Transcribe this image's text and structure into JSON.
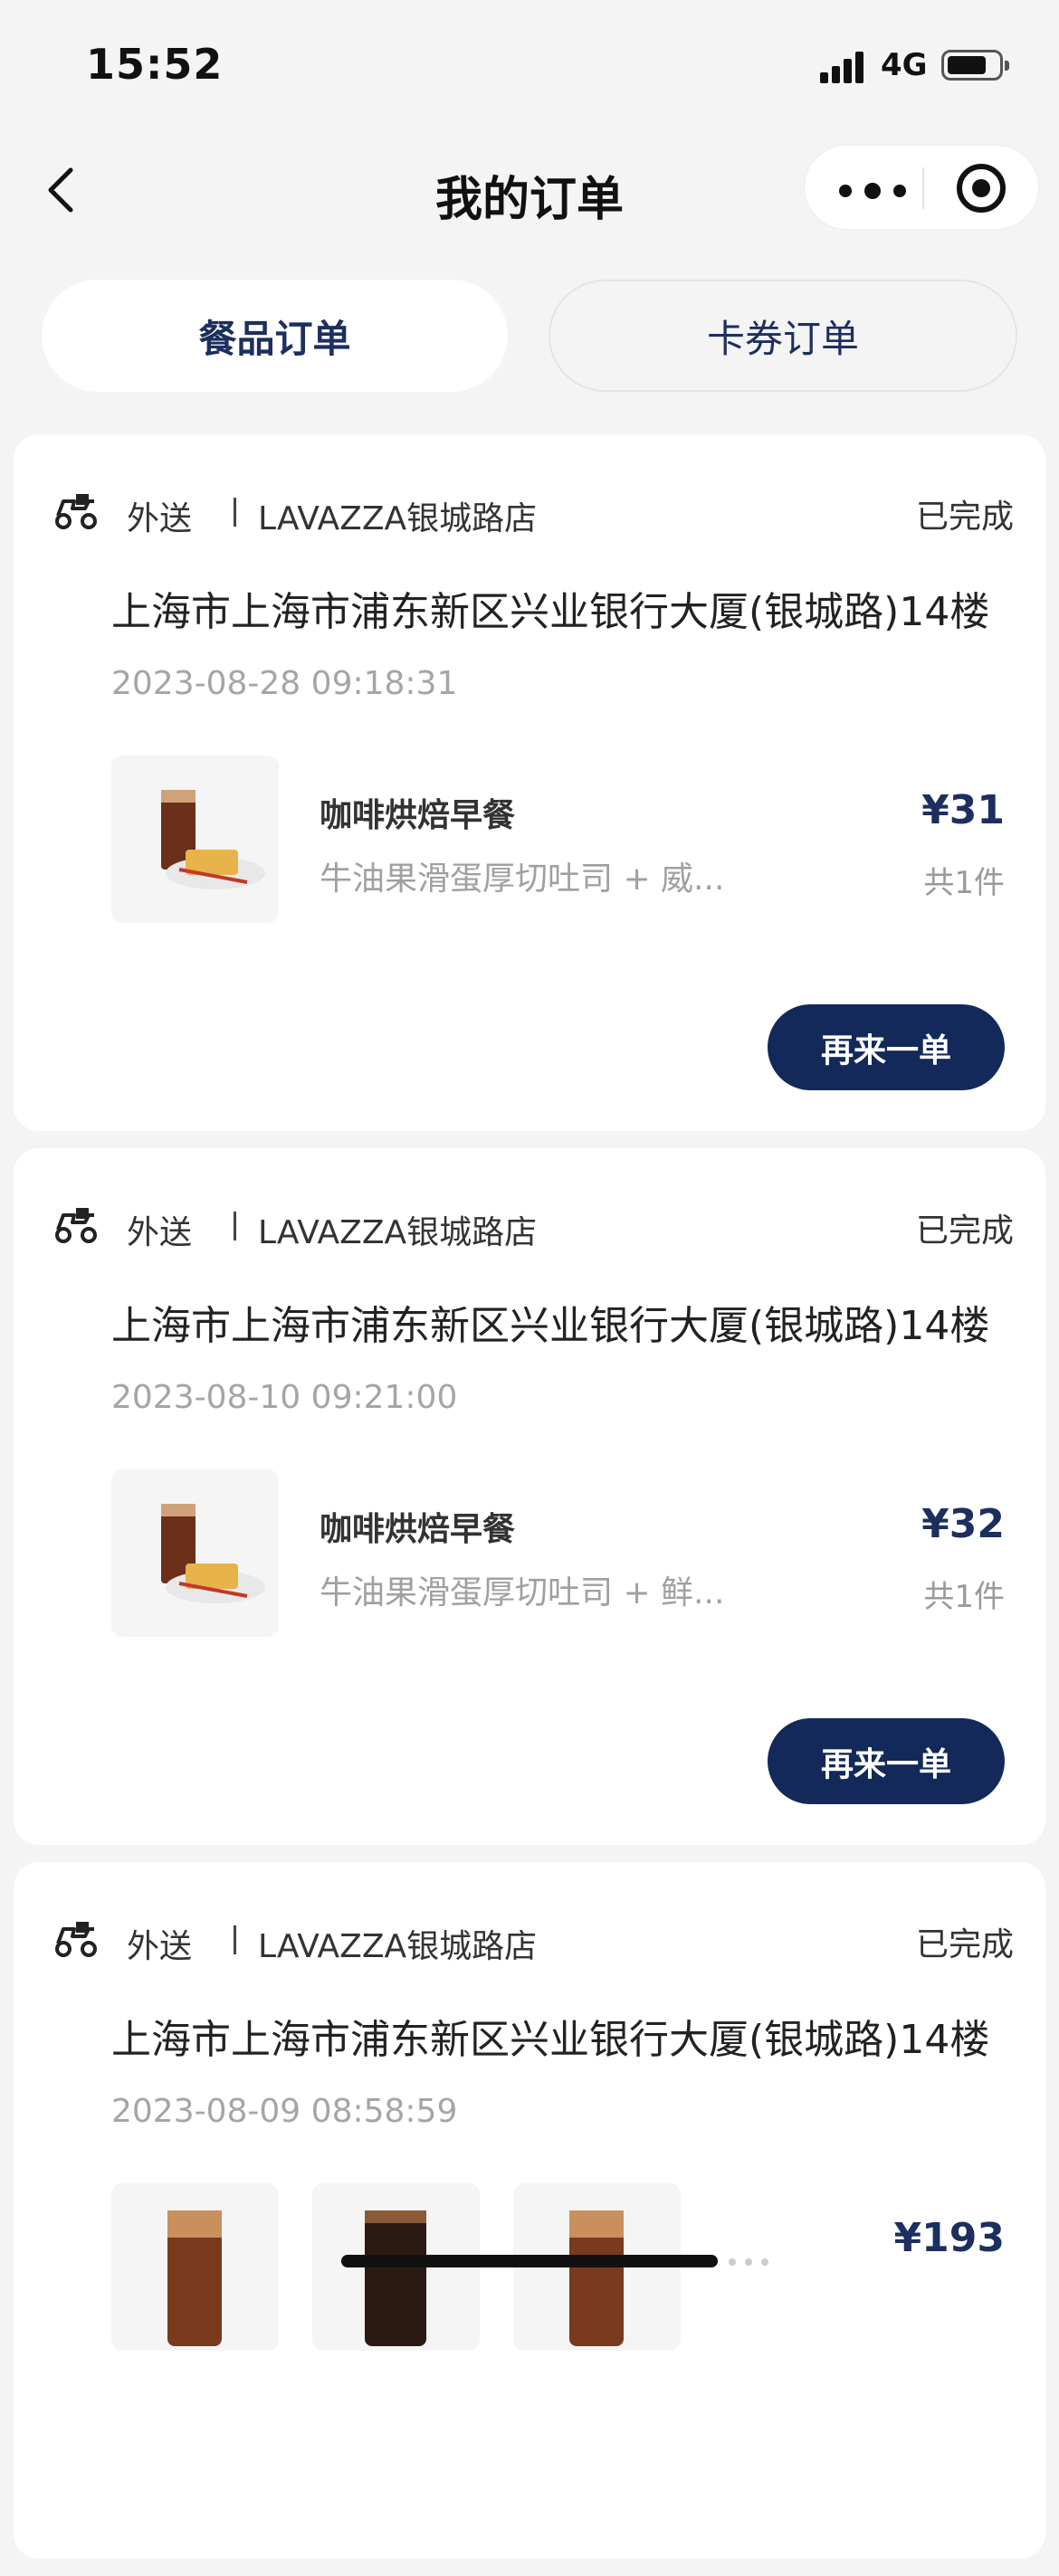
{
  "status_bar": {
    "time": "15:52",
    "network": "4G"
  },
  "nav": {
    "title": "我的订单"
  },
  "tabs": [
    {
      "label": "餐品订单",
      "active": true
    },
    {
      "label": "卡券订单",
      "active": false
    }
  ],
  "orders": [
    {
      "type": "外送",
      "store": "LAVAZZA银城路店",
      "status": "已完成",
      "address": "上海市上海市浦东新区兴业银行大厦(银城路)14楼",
      "time": "2023-08-28 09:18:31",
      "item_name": "咖啡烘焙早餐",
      "item_desc": "牛油果滑蛋厚切吐司 + 威...",
      "price": "¥31",
      "count": "共1件",
      "action": "再来一单"
    },
    {
      "type": "外送",
      "store": "LAVAZZA银城路店",
      "status": "已完成",
      "address": "上海市上海市浦东新区兴业银行大厦(银城路)14楼",
      "time": "2023-08-10 09:21:00",
      "item_name": "咖啡烘焙早餐",
      "item_desc": "牛油果滑蛋厚切吐司 + 鲜...",
      "price": "¥32",
      "count": "共1件",
      "action": "再来一单"
    },
    {
      "type": "外送",
      "store": "LAVAZZA银城路店",
      "status": "已完成",
      "address": "上海市上海市浦东新区兴业银行大厦(银城路)14楼",
      "time": "2023-08-09 08:58:59",
      "price": "¥193"
    }
  ],
  "colors": {
    "brand_navy": "#12295a",
    "price_navy": "#1c2f5e",
    "background": "#f4f4f5"
  },
  "icons": [
    "back-arrow-icon",
    "more-dots-icon",
    "close-target-icon",
    "scooter-delivery-icon"
  ]
}
